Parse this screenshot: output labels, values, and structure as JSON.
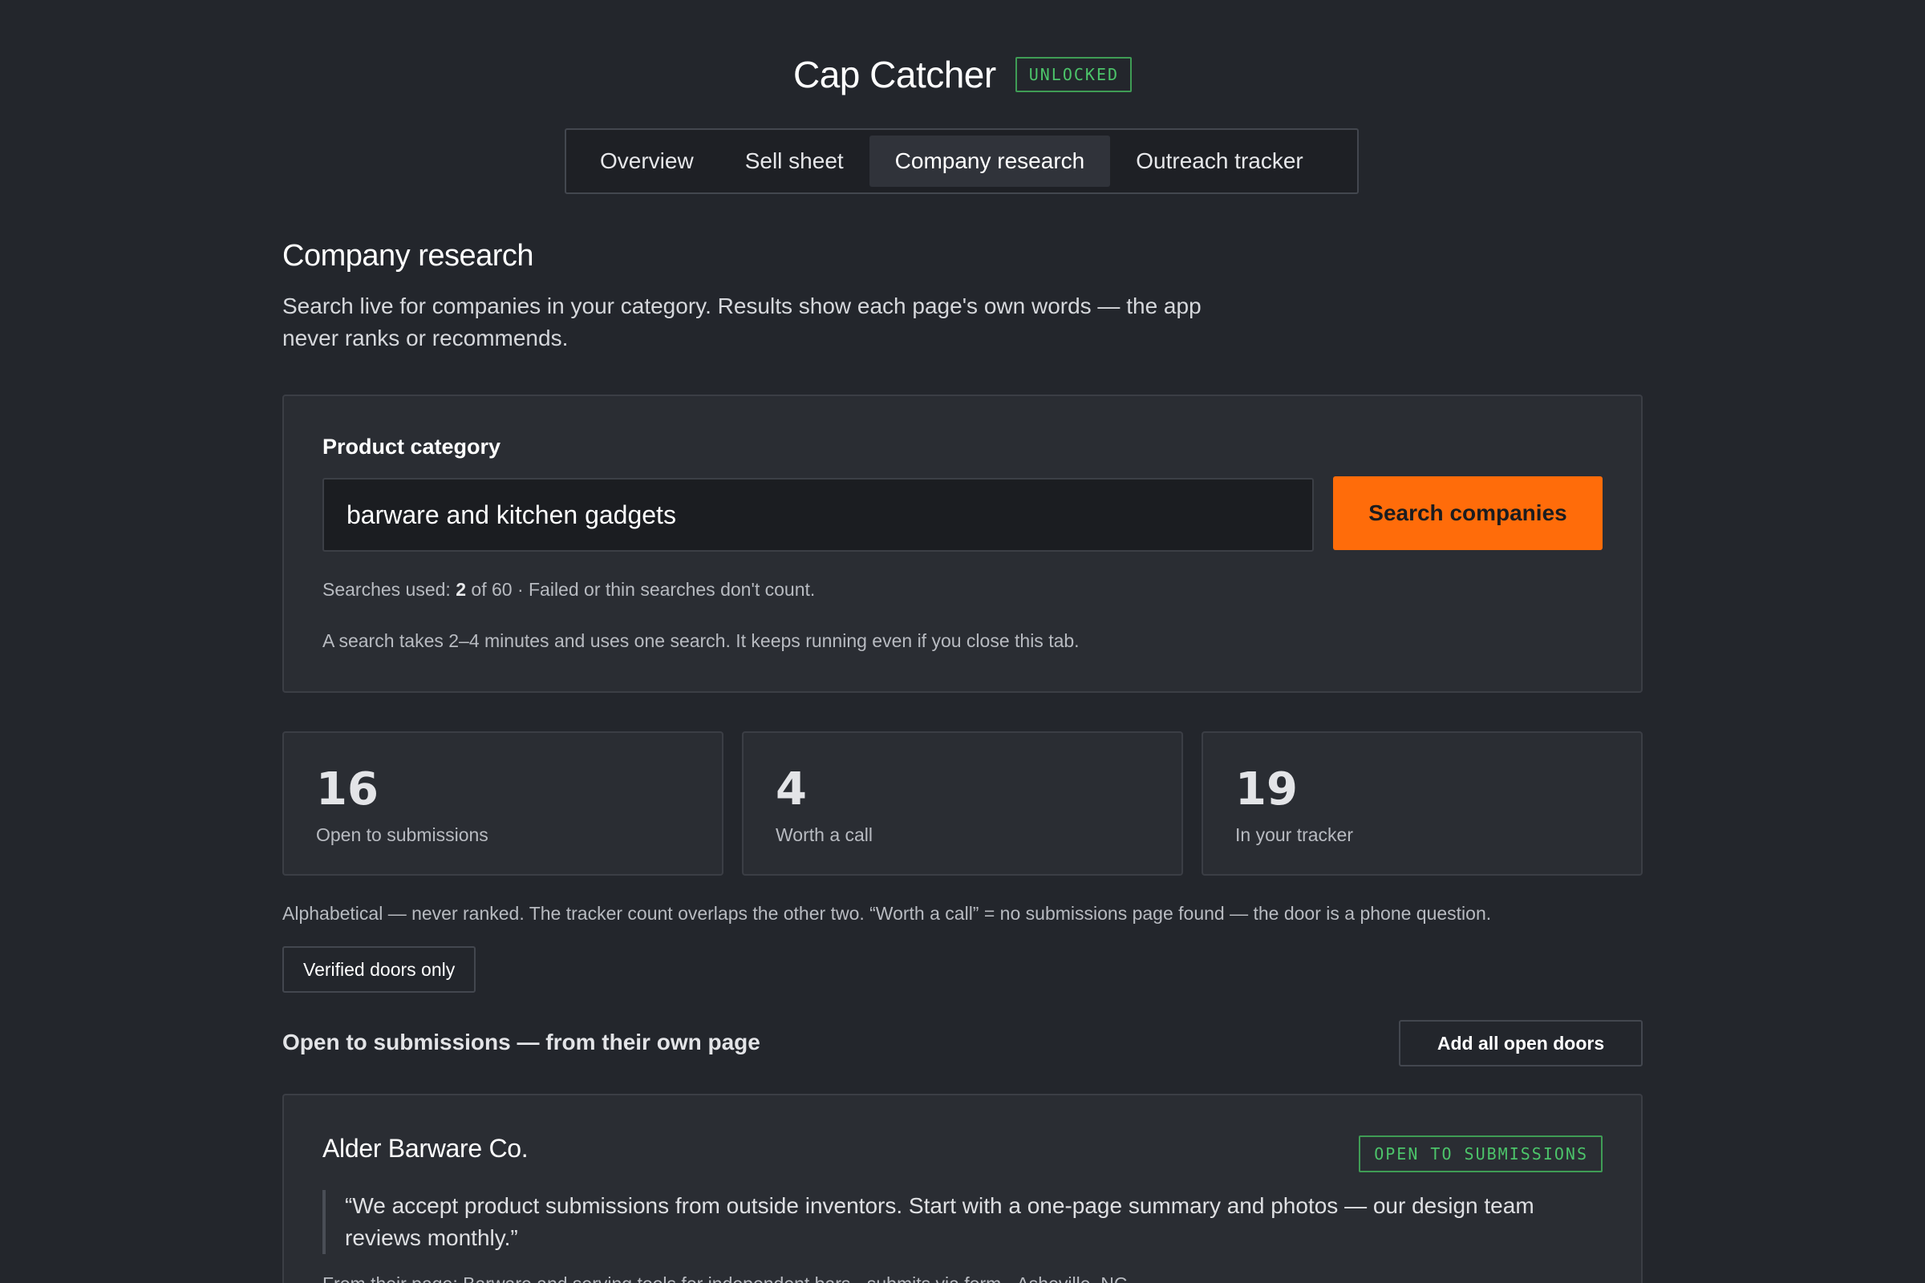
{
  "app": {
    "title": "Cap Catcher",
    "badge": "UNLOCKED"
  },
  "tabs": [
    {
      "label": "Overview",
      "active": false
    },
    {
      "label": "Sell sheet",
      "active": false
    },
    {
      "label": "Company research",
      "active": true
    },
    {
      "label": "Outreach tracker",
      "active": false
    }
  ],
  "section": {
    "title": "Company research",
    "description": "Search live for companies in your category. Results show each page's own words — the app never ranks or recommends."
  },
  "search": {
    "label": "Product category",
    "value": "barware and kitchen gadgets",
    "button_label": "Search companies",
    "used_prefix": "Searches used: ",
    "used_count": "2",
    "used_suffix": " of 60 · Failed or thin searches don't count.",
    "note": "A search takes 2–4 minutes and uses one search. It keeps running even if you close this tab."
  },
  "stats": [
    {
      "number": "16",
      "label": "Open to submissions"
    },
    {
      "number": "4",
      "label": "Worth a call"
    },
    {
      "number": "19",
      "label": "In your tracker"
    }
  ],
  "stats_note": "Alphabetical — never ranked. The tracker count overlaps the other two. “Worth a call” = no submissions page found — the door is a phone question.",
  "filter_label": "Verified doors only",
  "list": {
    "heading": "Open to submissions — from their own page",
    "add_all_label": "Add all open doors"
  },
  "companies": [
    {
      "name": "Alder Barware Co.",
      "badge": "OPEN TO SUBMISSIONS",
      "quote": "“We accept product submissions from outside inventors. Start with a one-page summary and photos — our design team reviews monthly.”",
      "meta": "From their page: Barware and serving tools for independent bars · submits via form · Asheville, NC"
    }
  ],
  "colors": {
    "background": "#23262c",
    "accent": "#ff6c0a",
    "badge_green": "#4cc46a"
  }
}
